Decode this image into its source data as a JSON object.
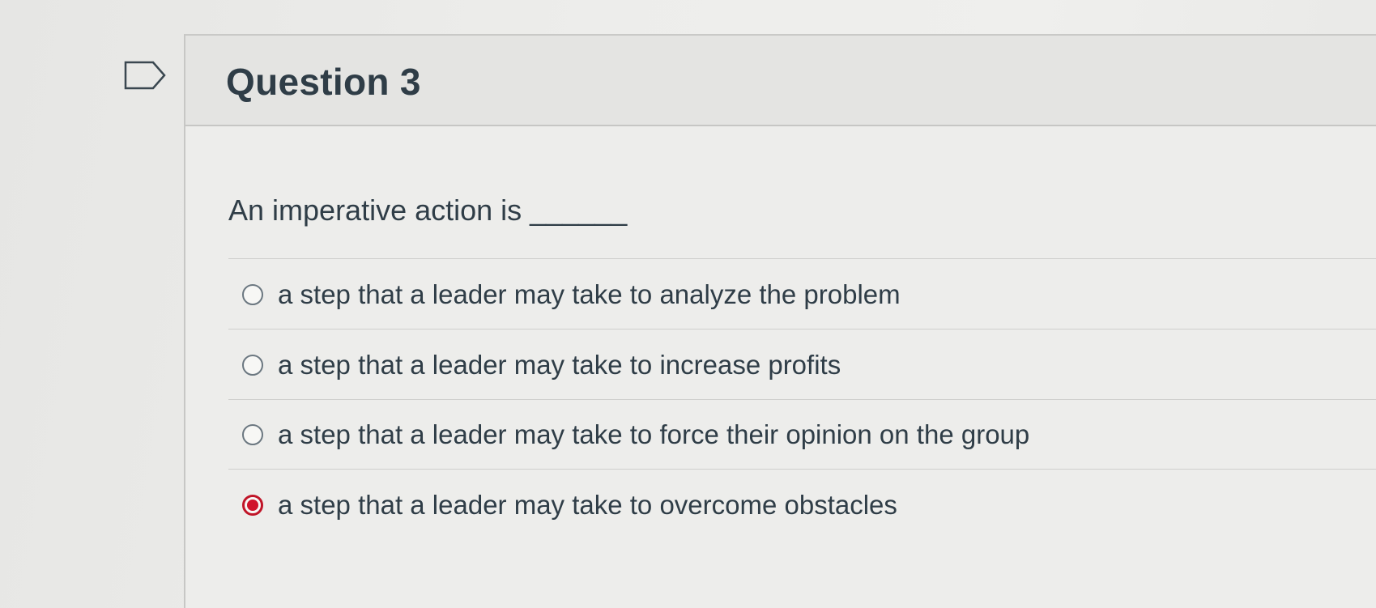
{
  "question": {
    "title": "Question 3",
    "prompt": "An imperative action is ______",
    "flag_icon": "flag-outline-icon"
  },
  "answers": [
    {
      "label": "a step that a leader may take to analyze the problem",
      "selected": false
    },
    {
      "label": "a step that a leader may take to increase profits",
      "selected": false
    },
    {
      "label": "a step that a leader may take to force their opinion on the group",
      "selected": false
    },
    {
      "label": "a step that a leader may take to overcome obstacles",
      "selected": true
    }
  ],
  "colors": {
    "selected_radio": "#d0142c",
    "text": "#2f3d47"
  }
}
